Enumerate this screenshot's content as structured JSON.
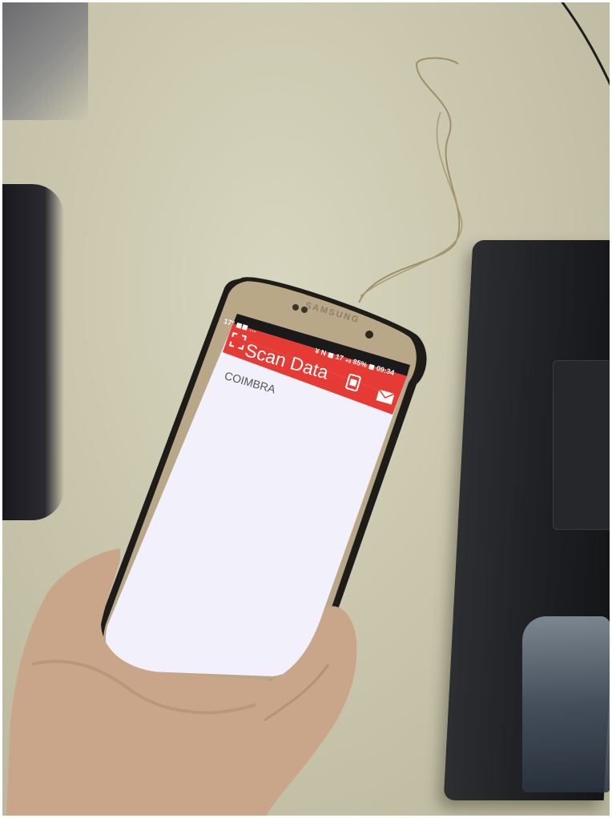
{
  "phone": {
    "brand": "SAMSUNG",
    "status_left": "17° ◼◼ …",
    "status_right": "¥ N ◼ 17 ₊ᵢₗ 85% ◼ 09:34",
    "app_title": "Scan Data",
    "content_value": "COIMBRA"
  },
  "icons": {
    "scan": "scan-frame-icon",
    "action_1": "document-icon",
    "action_2": "mail-icon"
  },
  "colors": {
    "app_bar": "#e63b35",
    "screen": "#f1f0fb",
    "desk": "#cac7ae"
  }
}
